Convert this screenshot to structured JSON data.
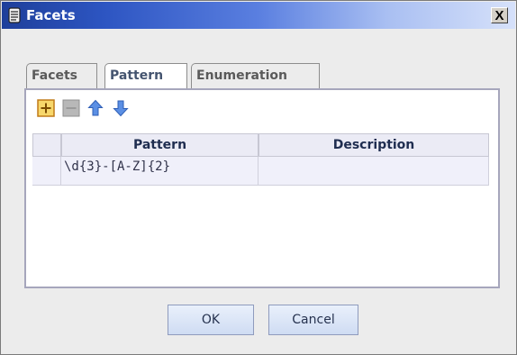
{
  "window": {
    "title": "Facets",
    "close_label": "X"
  },
  "tabs": [
    {
      "label": "Facets",
      "active": false
    },
    {
      "label": "Pattern",
      "active": true
    },
    {
      "label": "Enumeration",
      "active": false
    }
  ],
  "toolbar": {
    "buttons": [
      {
        "name": "add",
        "icon": "plus-icon",
        "enabled": true
      },
      {
        "name": "remove",
        "icon": "minus-icon",
        "enabled": false
      },
      {
        "name": "move-up",
        "icon": "arrow-up-icon",
        "enabled": true
      },
      {
        "name": "move-down",
        "icon": "arrow-down-icon",
        "enabled": true
      }
    ]
  },
  "table": {
    "columns": [
      "Pattern",
      "Description"
    ],
    "rows": [
      {
        "pattern": "\\d{3}-[A-Z]{2}",
        "description": ""
      }
    ]
  },
  "buttons": {
    "ok": "OK",
    "cancel": "Cancel"
  },
  "colors": {
    "titlebar_start": "#1e3f9a",
    "titlebar_end": "#d6e1fa",
    "active_tab_text": "#44546f",
    "header_bg": "#ebebf5",
    "row_bg": "#f0f0fa"
  }
}
